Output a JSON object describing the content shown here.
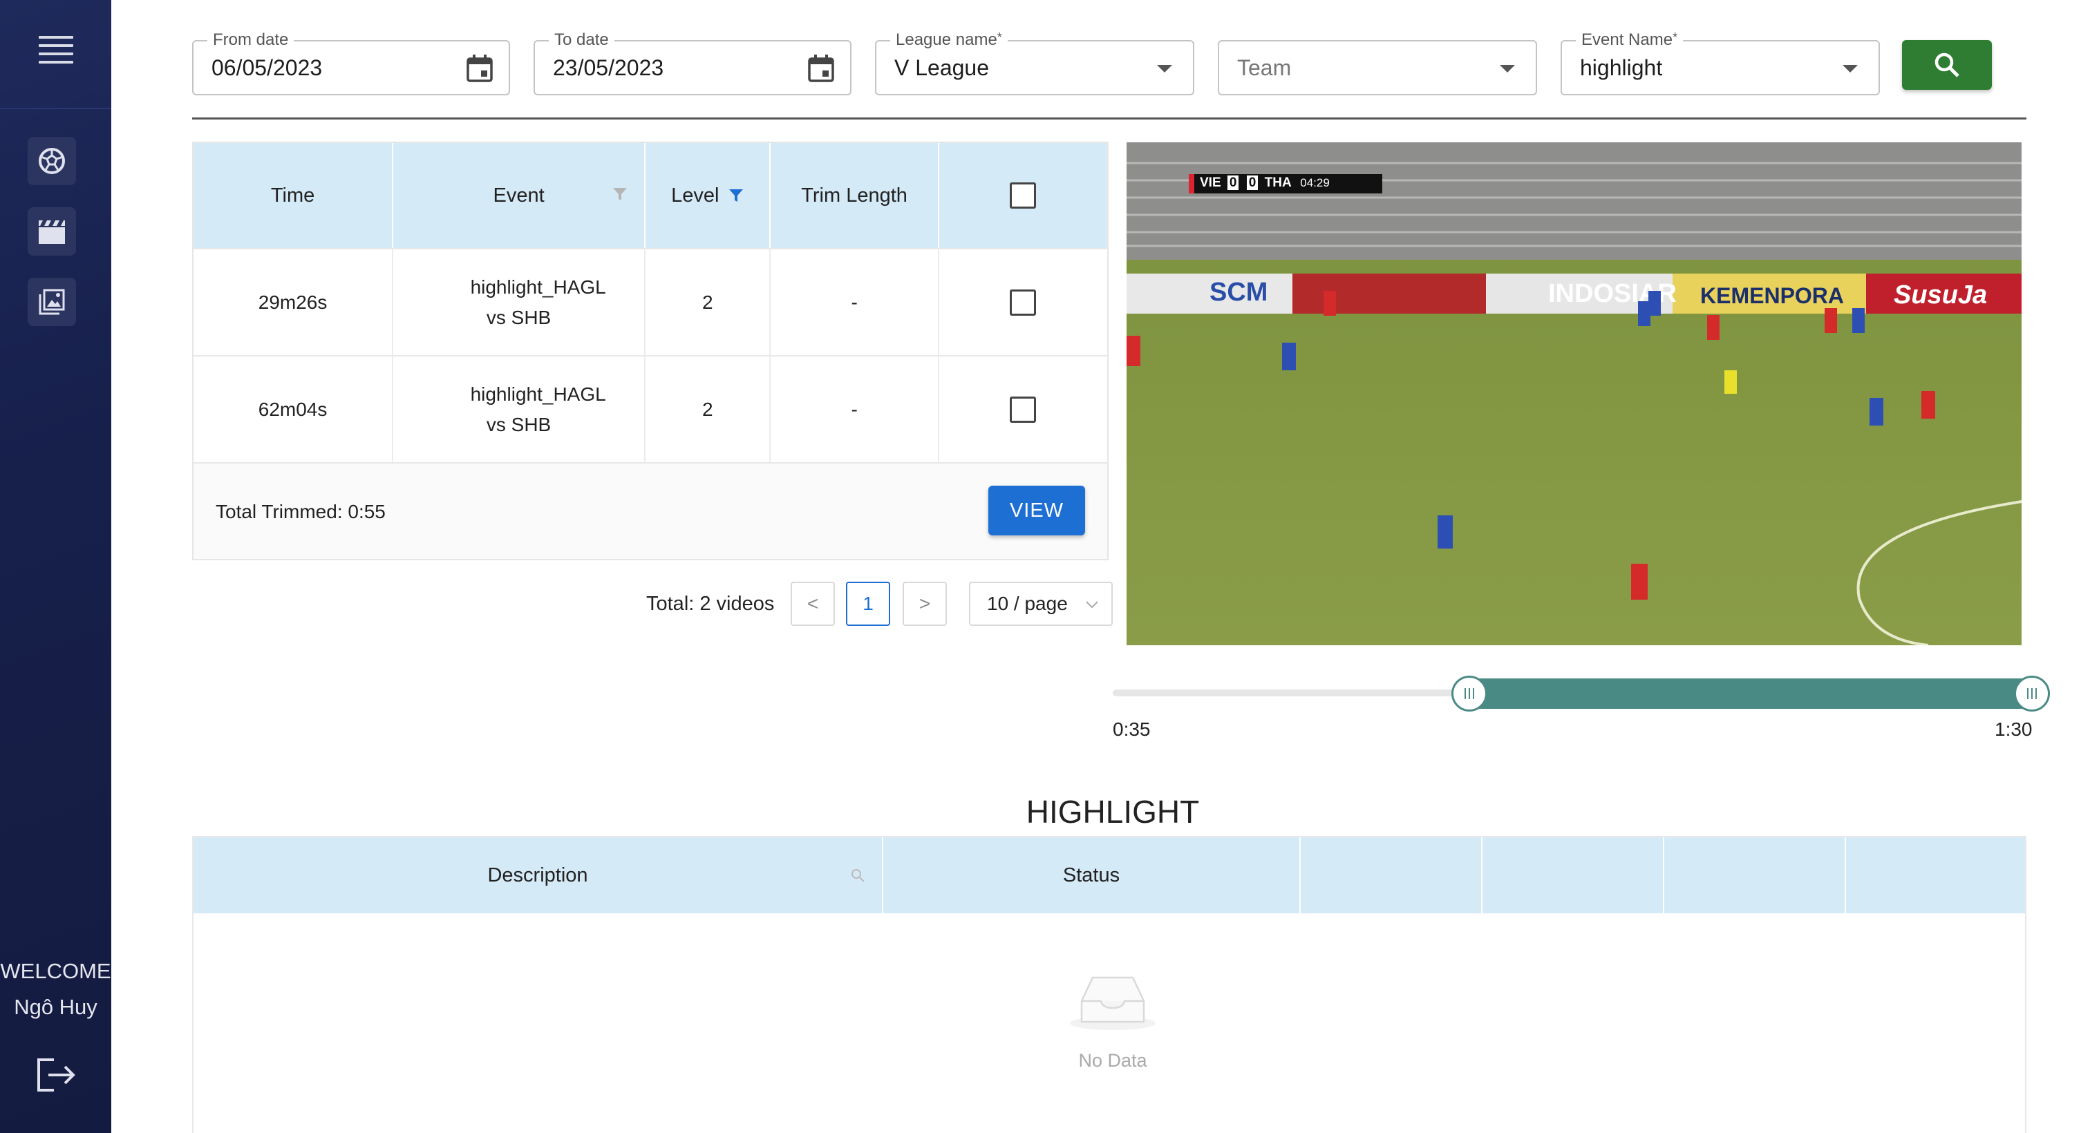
{
  "sidebar": {
    "nav": [
      {
        "icon": "soccer-ball-icon"
      },
      {
        "icon": "clapperboard-icon"
      },
      {
        "icon": "gallery-icon"
      }
    ],
    "welcome_label": "WELCOME",
    "user_name": "Ngô Huy"
  },
  "filters": {
    "from_date": {
      "label": "From date",
      "value": "06/05/2023"
    },
    "to_date": {
      "label": "To date",
      "value": "23/05/2023"
    },
    "league": {
      "label": "League name",
      "required_mark": "*",
      "value": "V League"
    },
    "team": {
      "placeholder": "Team"
    },
    "event_name": {
      "label": "Event Name",
      "required_mark": "*",
      "value": "highlight"
    }
  },
  "events_table": {
    "columns": [
      "Time",
      "Event",
      "Level",
      "Trim Length"
    ],
    "rows": [
      {
        "time": "29m26s",
        "event": "highlight_HAGL vs SHB",
        "level": "2",
        "trim_length": "-"
      },
      {
        "time": "62m04s",
        "event": "highlight_HAGL vs SHB",
        "level": "2",
        "trim_length": "-"
      }
    ],
    "total_trimmed": "Total Trimmed: 0:55",
    "view_label": "VIEW"
  },
  "pagination": {
    "total": "Total: 2 videos",
    "prev": "<",
    "current_page": "1",
    "next": ">",
    "page_size": "10 / page"
  },
  "video": {
    "scoreboard": {
      "home": "VIE",
      "home_score": "0",
      "away_score": "0",
      "away": "THA",
      "clock": "04:29"
    },
    "boards": [
      "SCM",
      "INDOSIAR",
      "KEMENPORA",
      "SusuJa"
    ]
  },
  "trim_slider": {
    "start_label": "0:35",
    "end_label": "1:30",
    "selected_start_fraction": 0.39,
    "selected_end_fraction": 1.0
  },
  "highlight": {
    "title": "HIGHLIGHT",
    "columns": [
      "Description",
      "Status",
      "",
      "",
      "",
      ""
    ],
    "empty_text": "No Data"
  },
  "colors": {
    "sidebar": "#17204b",
    "table_header": "#d5eaf7",
    "search_button": "#2e7d32",
    "view_button": "#1e6fd3",
    "slider": "#4a8a85"
  }
}
